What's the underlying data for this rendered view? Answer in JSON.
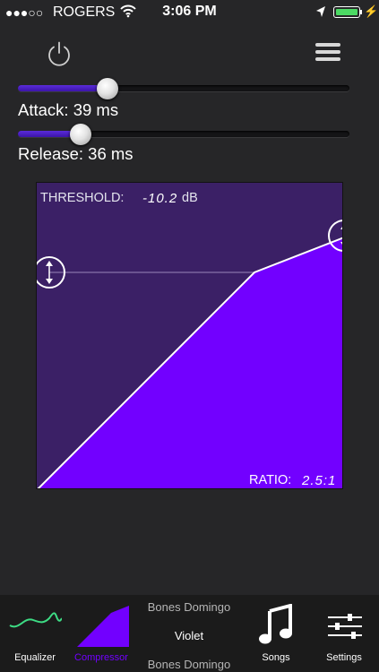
{
  "status_bar": {
    "signal": "●●●○○",
    "carrier": "ROGERS",
    "time": "3:06 PM",
    "battery_color": "#4cd964"
  },
  "toolbar": {
    "power_icon": "power-icon",
    "menu_icon": "hamburger-menu-icon"
  },
  "attack": {
    "label": "Attack: 39 ms",
    "level": 0.27
  },
  "release": {
    "label": "Release: 36 ms",
    "level": 0.19
  },
  "compressor": {
    "threshold_label": "THRESHOLD:",
    "threshold_value": "-10.2",
    "threshold_unit": "dB",
    "ratio_label": "RATIO:",
    "ratio_value": "2.5:1",
    "colors": {
      "background": "#3b2066",
      "fill": "#7200ff",
      "accent": "#5a2bd9"
    }
  },
  "tab_bar": {
    "equalizer": {
      "label": "Equalizer",
      "icon": "equalizer-wave-icon"
    },
    "compressor": {
      "label": "Compressor",
      "icon": "compressor-ramp-icon",
      "active": true
    },
    "now_playing": {
      "artist": "Bones Domingo",
      "title": "Violet",
      "album": "Bones Domingo"
    },
    "songs": {
      "label": "Songs",
      "icon": "music-note-icon"
    },
    "settings": {
      "label": "Settings",
      "icon": "sliders-icon"
    }
  }
}
